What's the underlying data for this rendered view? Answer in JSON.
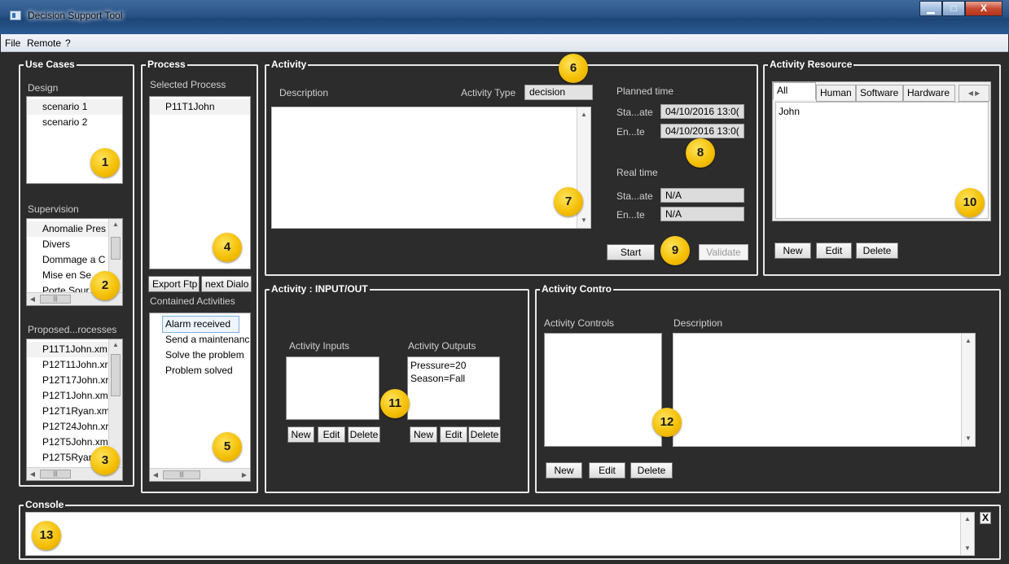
{
  "window": {
    "title": "Decision Support Tool",
    "min": "▁",
    "max": "□",
    "close": "X"
  },
  "menu": {
    "file": "File",
    "remote": "Remote",
    "help": "?"
  },
  "usecases": {
    "title": "Use Cases",
    "design_label": "Design",
    "design_items": [
      "scenario 1",
      "scenario 2"
    ],
    "supervision_label": "Supervision",
    "supervision_items": [
      "Anomalie Pres",
      "Divers",
      "Dommage a C",
      "Mise en Se",
      "Porte Sour"
    ],
    "proposed_label": "Proposed...rocesses",
    "proposed_items": [
      "P11T1John.xm",
      "P12T11John.xr",
      "P12T17John.xr",
      "P12T1John.xm",
      "P12T1Ryan.xm",
      "P12T24John.xr",
      "P12T5John.xm",
      "P12T5Ryan"
    ]
  },
  "process": {
    "title": "Process",
    "selected_label": "Selected Process",
    "selected_items": [
      "P11T1John"
    ],
    "export_btn": "Export Ftp",
    "next_btn": "next Dialo",
    "contained_label": "Contained Activities",
    "activities": [
      "Alarm received",
      "Send a maintenanc",
      "Solve the problem",
      "Problem solved"
    ]
  },
  "activity": {
    "title": "Activity",
    "description_label": "Description",
    "type_label": "Activity Type",
    "type_value": "decision",
    "planned_label": "Planned time",
    "start_label": "Sta...ate",
    "end_label": "En...te",
    "planned_start": "04/10/2016 13:0(",
    "planned_end": "04/10/2016 13:0(",
    "real_label": "Real time",
    "real_start": "N/A",
    "real_end": "N/A",
    "start_btn": "Start",
    "validate_btn": "Validate"
  },
  "resource": {
    "title": "Activity Resource",
    "tabs": [
      "All",
      "Human",
      "Software",
      "Hardware"
    ],
    "items": [
      "John"
    ],
    "new_btn": "New",
    "edit_btn": "Edit",
    "delete_btn": "Delete"
  },
  "io": {
    "title": "Activity : INPUT/OUT",
    "inputs_label": "Activity Inputs",
    "outputs_label": "Activity Outputs",
    "outputs": [
      "Pressure=20",
      "Season=Fall"
    ],
    "new_btn": "New",
    "edit_btn": "Edit",
    "delete_btn": "Delete"
  },
  "control": {
    "title": "Activity Contro",
    "controls_label": "Activity Controls",
    "description_label": "Description",
    "new_btn": "New",
    "edit_btn": "Edit",
    "delete_btn": "Delete"
  },
  "console": {
    "title": "Console",
    "close": "X"
  },
  "badges": [
    "1",
    "2",
    "3",
    "4",
    "5",
    "6",
    "7",
    "8",
    "9",
    "10",
    "11",
    "12",
    "13"
  ]
}
